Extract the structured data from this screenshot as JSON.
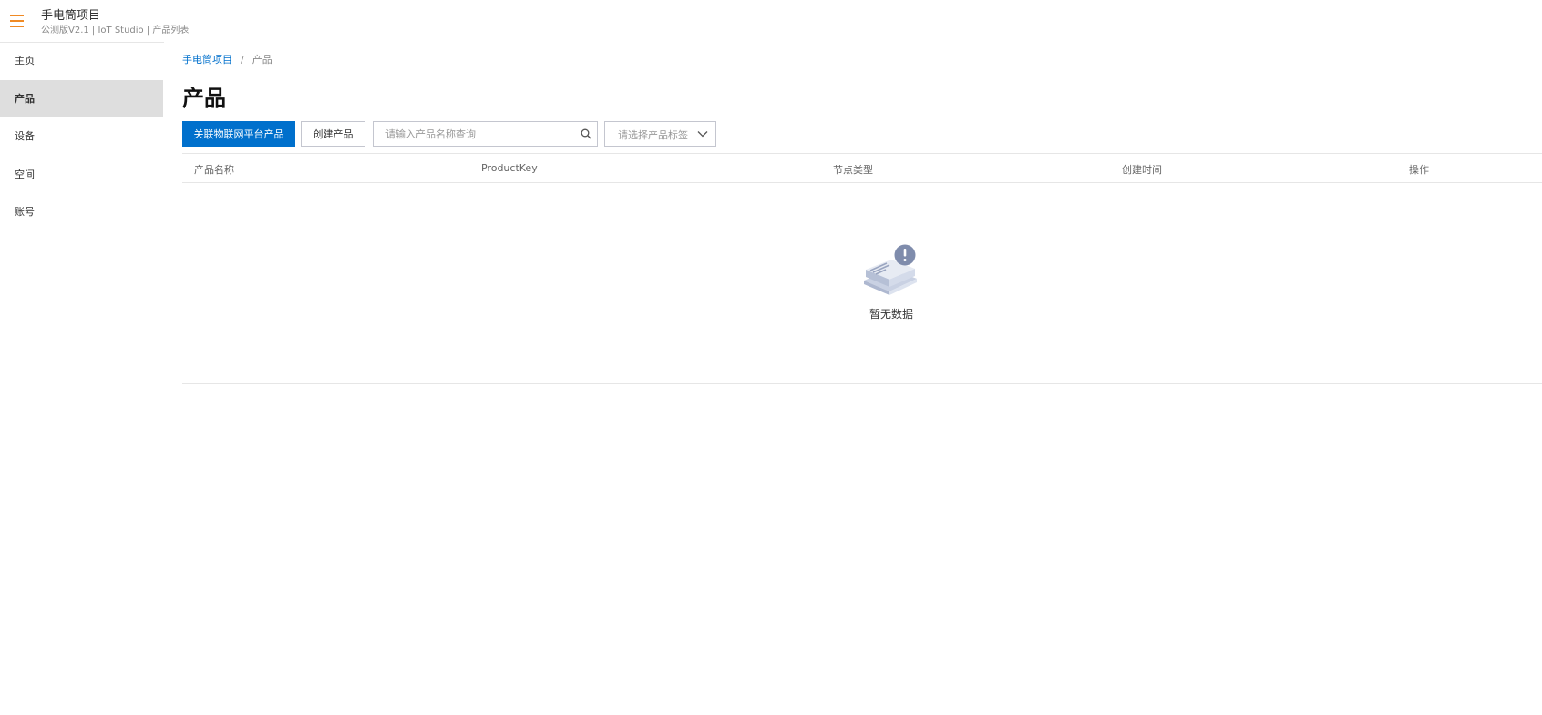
{
  "header": {
    "title": "手电筒项目",
    "subtitle": "公测版V2.1 | IoT Studio | 产品列表"
  },
  "sidebar": {
    "items": [
      {
        "label": "主页"
      },
      {
        "label": "产品"
      },
      {
        "label": "设备"
      },
      {
        "label": "空间"
      },
      {
        "label": "账号"
      }
    ],
    "active": "产品"
  },
  "breadcrumb": {
    "items": [
      "手电筒项目",
      "产品"
    ],
    "separator": "/"
  },
  "page": {
    "title": "产品"
  },
  "toolbar": {
    "link_button_label": "关联物联网平台产品",
    "create_button_label": "创建产品",
    "search_placeholder": "请输入产品名称查询",
    "tag_select_placeholder": "请选择产品标签"
  },
  "table": {
    "columns": [
      "产品名称",
      "ProductKey",
      "节点类型",
      "创建时间",
      "操作"
    ],
    "rows": [],
    "empty_text": "暂无数据"
  },
  "icons": {
    "menu": "hamburger-menu-icon",
    "search": "search-icon",
    "select": "chevron-down-icon",
    "empty": "empty-box-icon"
  },
  "colors": {
    "primary": "#0070cc",
    "menu_accent": "#f08a24",
    "active_nav_bg": "#dedede"
  }
}
